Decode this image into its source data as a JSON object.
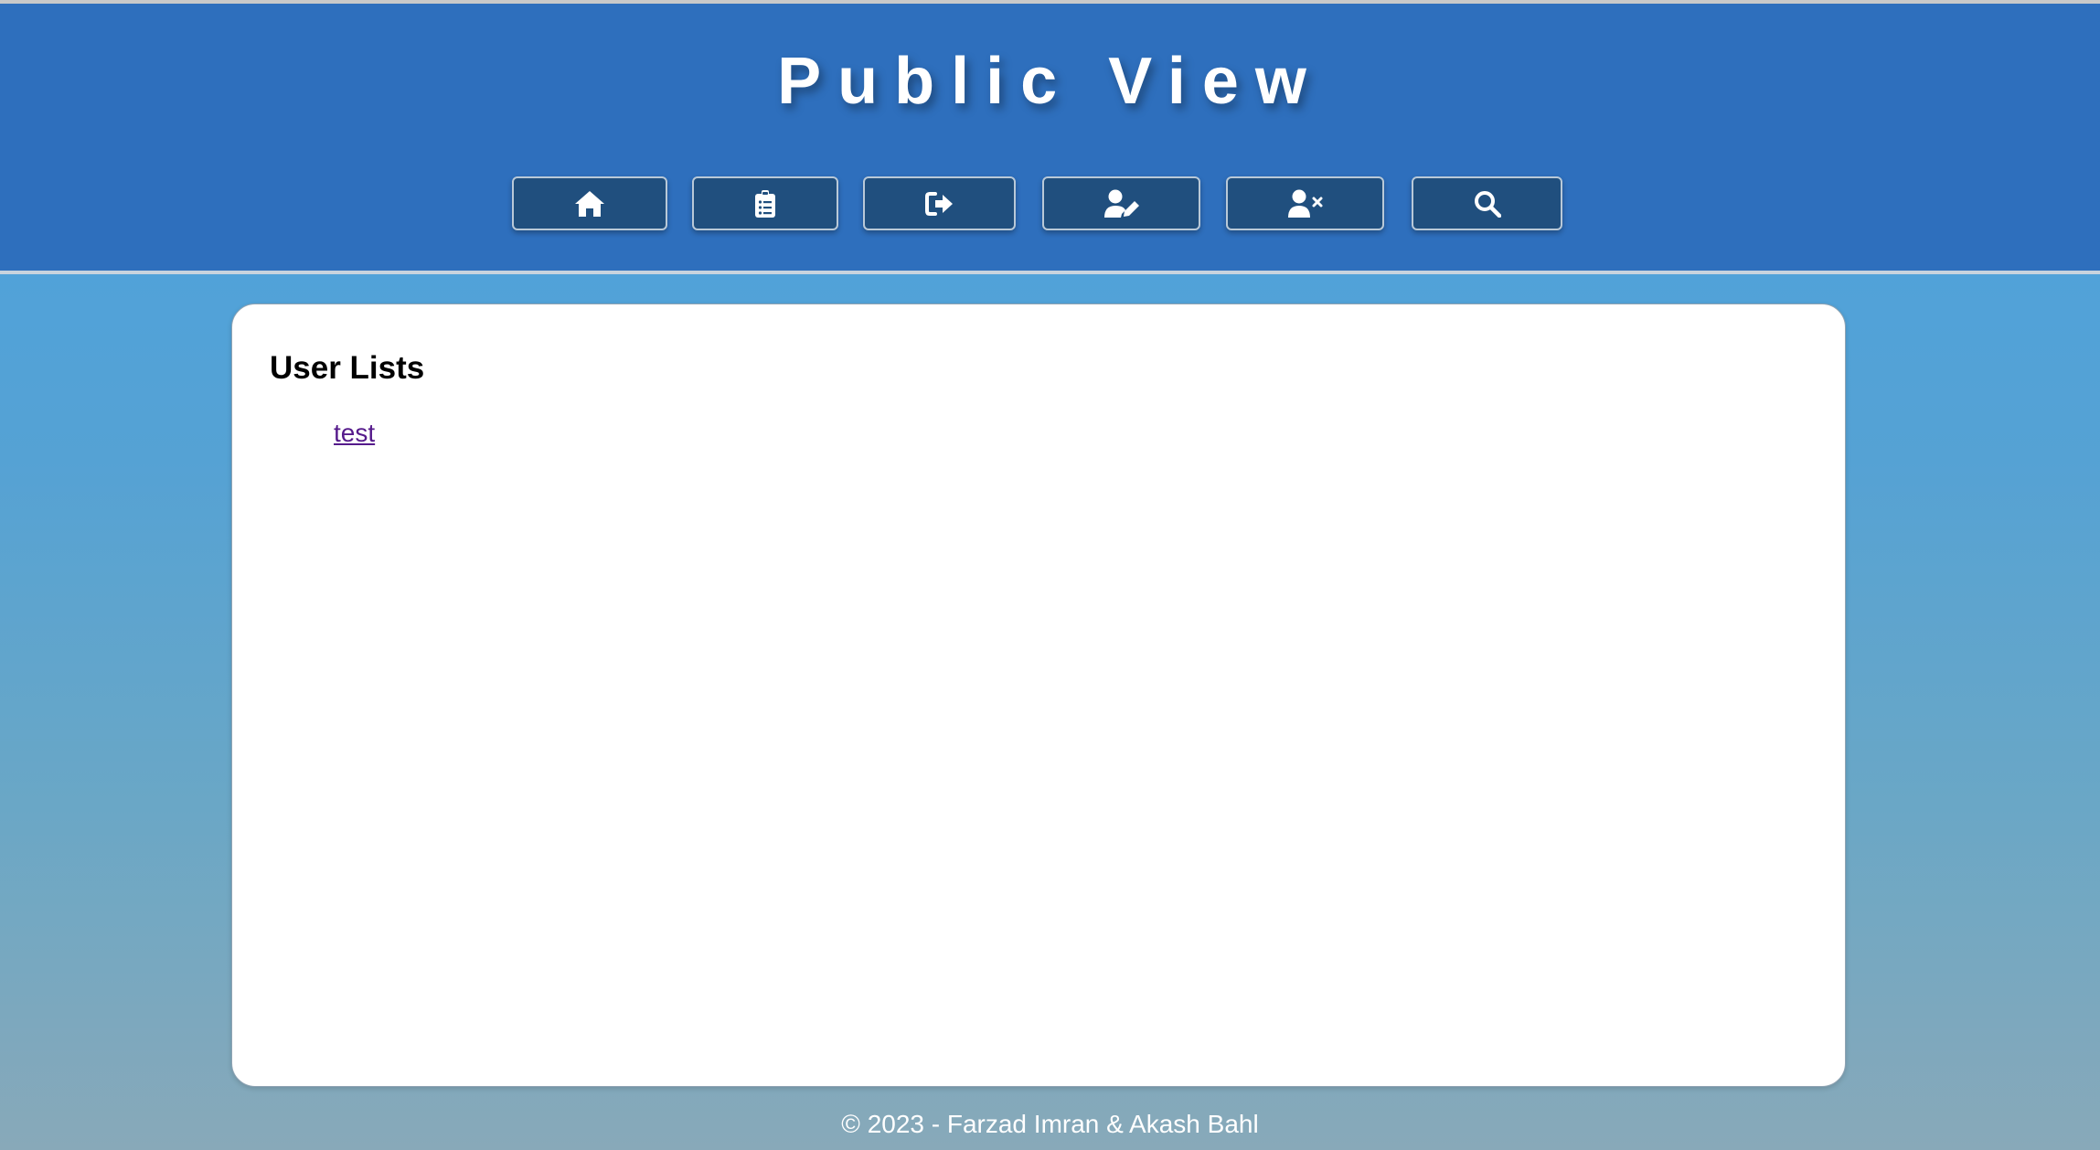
{
  "header": {
    "title": "Public View"
  },
  "nav": {
    "buttons": [
      {
        "id": "home",
        "icon": "home-icon"
      },
      {
        "id": "list",
        "icon": "clipboard-list-icon"
      },
      {
        "id": "logout",
        "icon": "sign-out-icon"
      },
      {
        "id": "edit-user",
        "icon": "user-edit-icon"
      },
      {
        "id": "delete-user",
        "icon": "user-remove-icon"
      },
      {
        "id": "search",
        "icon": "search-icon"
      }
    ]
  },
  "main": {
    "title": "User Lists",
    "users": [
      "test"
    ]
  },
  "footer": {
    "text": "© 2023 - Farzad Imran & Akash Bahl"
  },
  "colors": {
    "header_bg": "#2e6fbd",
    "button_bg": "#204f7e",
    "link": "#551a8b"
  }
}
